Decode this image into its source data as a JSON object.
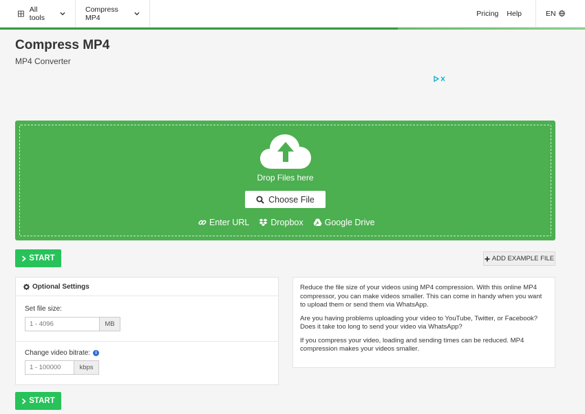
{
  "nav": {
    "all_tools": "All tools",
    "current_tool": "Compress MP4",
    "pricing": "Pricing",
    "help": "Help",
    "language": "EN"
  },
  "page": {
    "title": "Compress MP4",
    "subtitle": "MP4 Converter"
  },
  "dropzone": {
    "drop_text": "Drop Files here",
    "choose_file": "Choose File",
    "sources": [
      "Enter URL",
      "Dropbox",
      "Google Drive"
    ]
  },
  "actions": {
    "start": "START",
    "add_example": "ADD EXAMPLE FILE"
  },
  "settings": {
    "heading": "Optional Settings",
    "file_size_label": "Set file size:",
    "file_size_placeholder": "1 - 4096",
    "file_size_unit": "MB",
    "bitrate_label": "Change video bitrate:",
    "bitrate_placeholder": "1 - 100000",
    "bitrate_unit": "kbps"
  },
  "info": {
    "p1": "Reduce the file size of your videos using MP4 compression. With this online MP4 compressor, you can make videos smaller. This can come in handy when you want to upload them or send them via WhatsApp.",
    "p2": "Are you having problems uploading your video to YouTube, Twitter, or Facebook? Does it take too long to send your video via WhatsApp?",
    "p3": "If you compress your video, loading and sending times can be reduced. MP4 compression makes your videos smaller."
  },
  "colors": {
    "accent_green": "#4caf50",
    "start_green": "#27c25a"
  }
}
